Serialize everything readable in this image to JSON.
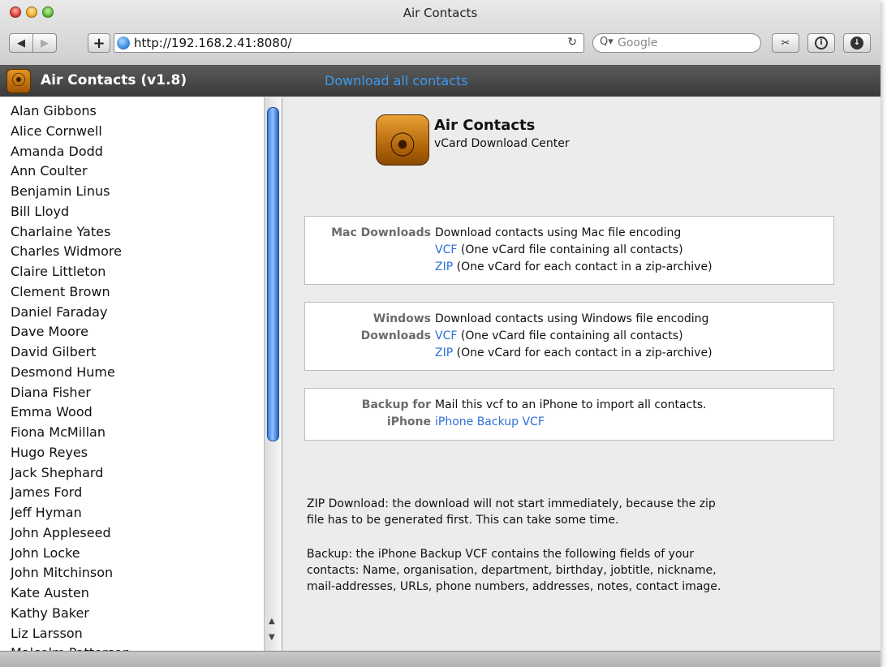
{
  "window": {
    "title": "Air Contacts"
  },
  "toolbar": {
    "back": "◀",
    "forward": "▶",
    "add_bookmark": "+",
    "url": "http://192.168.2.41:8080/",
    "reload": "↻",
    "search_placeholder": "Google",
    "search_icon": "Q▾",
    "snap_icon": "✂",
    "info_icon": "i",
    "download_icon": "↓"
  },
  "app": {
    "title": "Air Contacts (v1.8)",
    "download_all": "Download all contacts",
    "brand": "Air Contacts",
    "tagline": "vCard Download Center"
  },
  "contacts": [
    "Alan Gibbons",
    "Alice Cornwell",
    "Amanda Dodd",
    "Ann Coulter",
    "Benjamin Linus",
    "Bill Lloyd",
    "Charlaine Yates",
    "Charles Widmore",
    "Claire Littleton",
    "Clement Brown",
    "Daniel Faraday",
    "Dave Moore",
    "David Gilbert",
    "Desmond Hume",
    "Diana Fisher",
    "Emma Wood",
    "Fiona McMillan",
    "Hugo Reyes",
    "Jack Shephard",
    "James Ford",
    "Jeff Hyman",
    "John Appleseed",
    "John Locke",
    "John Mitchinson",
    "Kate Austen",
    "Kathy Baker",
    "Liz Larsson",
    "Malcolm Patterson"
  ],
  "mac": {
    "label": "Mac Downloads",
    "desc": "Download contacts using Mac file encoding",
    "vcf_link": "VCF",
    "vcf_desc": " (One vCard file containing all contacts)",
    "zip_link": "ZIP",
    "zip_desc": " (One vCard for each contact in a zip-archive)"
  },
  "windows": {
    "label_line1": "Windows",
    "label_line2": "Downloads",
    "desc": "Download contacts using Windows file encoding",
    "vcf_link": "VCF",
    "vcf_desc": " (One vCard file containing all contacts)",
    "zip_link": "ZIP",
    "zip_desc": " (One vCard for each contact in a zip-archive)"
  },
  "backup": {
    "label_line1": "Backup for",
    "label_line2": "iPhone",
    "desc": "Mail this vcf to an iPhone to import all contacts.",
    "link": "iPhone Backup VCF"
  },
  "notes": {
    "zip_line1": "ZIP Download: the download will not start immediately, because the zip",
    "zip_line2": "file has to be generated first. This can take some time.",
    "backup_line1": "Backup: the iPhone Backup VCF contains the following fields of your",
    "backup_line2": "contacts: Name, organisation, department, birthday, jobtitle, nickname,",
    "backup_line3": "mail-addresses, URLs, phone numbers, addresses, notes, contact image."
  },
  "colors": {
    "link": "#2b6fd6",
    "header_link": "#3b9bf2",
    "app_orange": "#c8740f"
  }
}
